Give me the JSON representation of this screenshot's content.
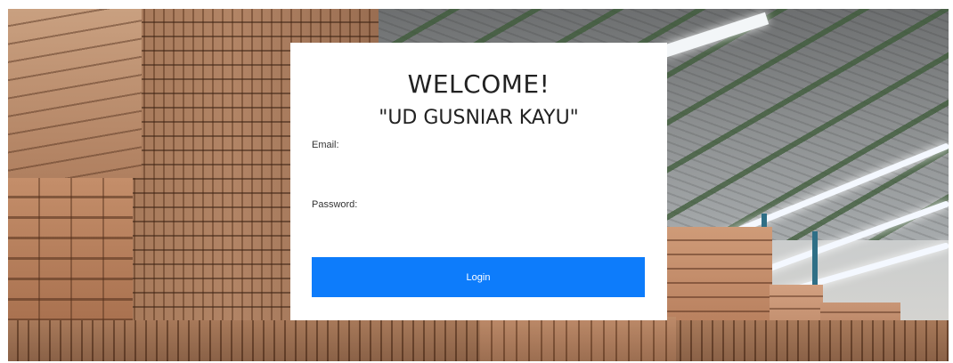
{
  "login": {
    "title": "WELCOME!",
    "subtitle": "\"UD GUSNIAR KAYU\"",
    "email_label": "Email:",
    "email_value": "",
    "password_label": "Password:",
    "password_value": "",
    "login_label": "Login"
  },
  "colors": {
    "button": "#0d7cfb",
    "button_text": "#ffffff",
    "card": "#ffffff",
    "text": "#222222"
  }
}
